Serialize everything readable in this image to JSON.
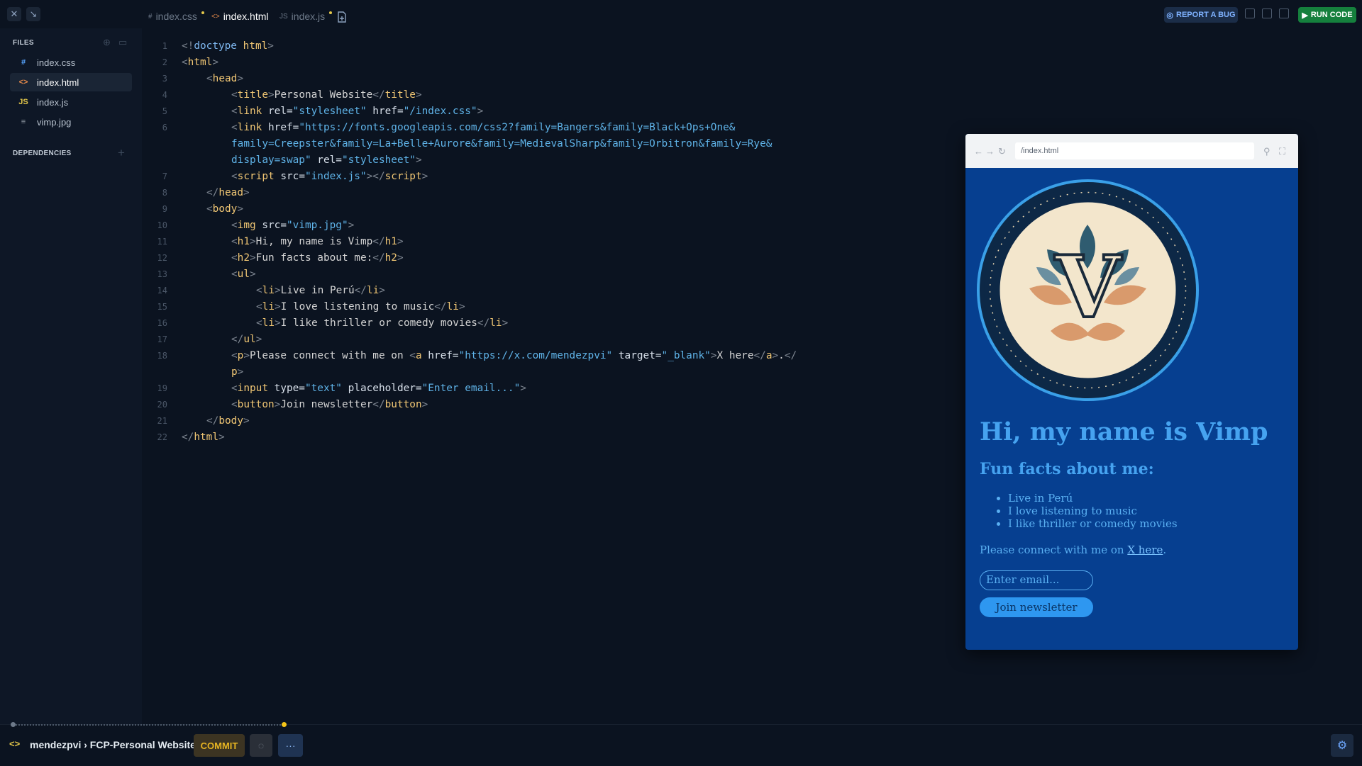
{
  "tabs": [
    {
      "icon": "#",
      "label": "index.css",
      "modified": true
    },
    {
      "icon": "<>",
      "label": "index.html",
      "modified": false,
      "active": true
    },
    {
      "icon": "JS",
      "label": "index.js",
      "modified": true
    }
  ],
  "toolbar": {
    "report_label": "REPORT A BUG",
    "run_label": "RUN CODE"
  },
  "sidebar": {
    "files_heading": "FILES",
    "dependencies_heading": "DEPENDENCIES",
    "files": [
      {
        "icon": "#",
        "name": "index.css",
        "icon_color": "#58a6ff"
      },
      {
        "icon": "<>",
        "name": "index.html",
        "icon_color": "#e2884a",
        "active": true
      },
      {
        "icon": "JS",
        "name": "index.js",
        "icon_color": "#e5c84a"
      },
      {
        "icon": "≡",
        "name": "vimp.jpg",
        "icon_color": "#8b949e"
      }
    ]
  },
  "editor": {
    "lines": [
      {
        "n": "1",
        "indent": 0,
        "tokens": [
          [
            "br",
            "<!"
          ],
          [
            "kw",
            "doctype "
          ],
          [
            "tag",
            "html"
          ],
          [
            "br",
            ">"
          ]
        ]
      },
      {
        "n": "2",
        "indent": 0,
        "tokens": [
          [
            "br",
            "<"
          ],
          [
            "tag",
            "html"
          ],
          [
            "br",
            ">"
          ]
        ]
      },
      {
        "n": "3",
        "indent": 1,
        "tokens": [
          [
            "br",
            "<"
          ],
          [
            "tag",
            "head"
          ],
          [
            "br",
            ">"
          ]
        ]
      },
      {
        "n": "4",
        "indent": 2,
        "tokens": [
          [
            "br",
            "<"
          ],
          [
            "tag",
            "title"
          ],
          [
            "br",
            ">"
          ],
          [
            "tx",
            "Personal Website"
          ],
          [
            "br",
            "</"
          ],
          [
            "tag",
            "title"
          ],
          [
            "br",
            ">"
          ]
        ]
      },
      {
        "n": "5",
        "indent": 2,
        "tokens": [
          [
            "br",
            "<"
          ],
          [
            "tag",
            "link "
          ],
          [
            "at",
            "rel="
          ],
          [
            "str",
            "\"stylesheet\""
          ],
          [
            "at",
            " href="
          ],
          [
            "str",
            "\"/index.css\""
          ],
          [
            "br",
            ">"
          ]
        ]
      },
      {
        "n": "6",
        "indent": 2,
        "tokens": [
          [
            "br",
            "<"
          ],
          [
            "tag",
            "link "
          ],
          [
            "at",
            "href="
          ],
          [
            "str",
            "\"https://fonts.googleapis.com/css2?family=Bangers&family=Black+Ops+One&"
          ]
        ]
      },
      {
        "n": "",
        "indent": 2,
        "tokens": [
          [
            "str",
            "family=Creepster&family=La+Belle+Aurore&family=MedievalSharp&family=Orbitron&family=Rye&"
          ]
        ]
      },
      {
        "n": "",
        "indent": 2,
        "tokens": [
          [
            "str",
            "display=swap\""
          ],
          [
            "at",
            " rel="
          ],
          [
            "str",
            "\"stylesheet\""
          ],
          [
            "br",
            ">"
          ]
        ]
      },
      {
        "n": "7",
        "indent": 2,
        "tokens": [
          [
            "br",
            "<"
          ],
          [
            "tag",
            "script "
          ],
          [
            "at",
            "src="
          ],
          [
            "str",
            "\"index.js\""
          ],
          [
            "br",
            "></"
          ],
          [
            "tag",
            "script"
          ],
          [
            "br",
            ">"
          ]
        ]
      },
      {
        "n": "8",
        "indent": 1,
        "tokens": [
          [
            "br",
            "</"
          ],
          [
            "tag",
            "head"
          ],
          [
            "br",
            ">"
          ]
        ]
      },
      {
        "n": "9",
        "indent": 1,
        "tokens": [
          [
            "br",
            "<"
          ],
          [
            "tag",
            "body"
          ],
          [
            "br",
            ">"
          ]
        ]
      },
      {
        "n": "10",
        "indent": 2,
        "tokens": [
          [
            "br",
            "<"
          ],
          [
            "tag",
            "img "
          ],
          [
            "at",
            "src="
          ],
          [
            "str",
            "\"vimp.jpg\""
          ],
          [
            "br",
            ">"
          ]
        ]
      },
      {
        "n": "11",
        "indent": 2,
        "tokens": [
          [
            "br",
            "<"
          ],
          [
            "tag",
            "h1"
          ],
          [
            "br",
            ">"
          ],
          [
            "tx",
            "Hi, my name is Vimp"
          ],
          [
            "br",
            "</"
          ],
          [
            "tag",
            "h1"
          ],
          [
            "br",
            ">"
          ]
        ]
      },
      {
        "n": "12",
        "indent": 2,
        "tokens": [
          [
            "br",
            "<"
          ],
          [
            "tag",
            "h2"
          ],
          [
            "br",
            ">"
          ],
          [
            "tx",
            "Fun facts about me:"
          ],
          [
            "br",
            "</"
          ],
          [
            "tag",
            "h2"
          ],
          [
            "br",
            ">"
          ]
        ]
      },
      {
        "n": "13",
        "indent": 2,
        "tokens": [
          [
            "br",
            "<"
          ],
          [
            "tag",
            "ul"
          ],
          [
            "br",
            ">"
          ]
        ]
      },
      {
        "n": "14",
        "indent": 3,
        "tokens": [
          [
            "br",
            "<"
          ],
          [
            "tag",
            "li"
          ],
          [
            "br",
            ">"
          ],
          [
            "tx",
            "Live in Perú"
          ],
          [
            "br",
            "</"
          ],
          [
            "tag",
            "li"
          ],
          [
            "br",
            ">"
          ]
        ]
      },
      {
        "n": "15",
        "indent": 3,
        "tokens": [
          [
            "br",
            "<"
          ],
          [
            "tag",
            "li"
          ],
          [
            "br",
            ">"
          ],
          [
            "tx",
            "I love listening to music"
          ],
          [
            "br",
            "</"
          ],
          [
            "tag",
            "li"
          ],
          [
            "br",
            ">"
          ]
        ]
      },
      {
        "n": "16",
        "indent": 3,
        "tokens": [
          [
            "br",
            "<"
          ],
          [
            "tag",
            "li"
          ],
          [
            "br",
            ">"
          ],
          [
            "tx",
            "I like thriller or comedy movies"
          ],
          [
            "br",
            "</"
          ],
          [
            "tag",
            "li"
          ],
          [
            "br",
            ">"
          ]
        ]
      },
      {
        "n": "17",
        "indent": 2,
        "tokens": [
          [
            "br",
            "</"
          ],
          [
            "tag",
            "ul"
          ],
          [
            "br",
            ">"
          ]
        ]
      },
      {
        "n": "18",
        "indent": 2,
        "tokens": [
          [
            "br",
            "<"
          ],
          [
            "tag",
            "p"
          ],
          [
            "br",
            ">"
          ],
          [
            "tx",
            "Please connect with me on "
          ],
          [
            "br",
            "<"
          ],
          [
            "tag",
            "a "
          ],
          [
            "at",
            "href="
          ],
          [
            "str",
            "\"https://x.com/mendezpvi\""
          ],
          [
            "at",
            " target="
          ],
          [
            "str",
            "\"_blank\""
          ],
          [
            "br",
            ">"
          ],
          [
            "tx",
            "X here"
          ],
          [
            "br",
            "</"
          ],
          [
            "tag",
            "a"
          ],
          [
            "br",
            ">"
          ],
          [
            "tx",
            "."
          ],
          [
            "br",
            "</"
          ]
        ]
      },
      {
        "n": "",
        "indent": 2,
        "tokens": [
          [
            "tag",
            "p"
          ],
          [
            "br",
            ">"
          ]
        ]
      },
      {
        "n": "19",
        "indent": 2,
        "tokens": [
          [
            "br",
            "<"
          ],
          [
            "tag",
            "input "
          ],
          [
            "at",
            "type="
          ],
          [
            "str",
            "\"text\""
          ],
          [
            "at",
            " placeholder="
          ],
          [
            "str",
            "\"Enter email...\""
          ],
          [
            "br",
            ">"
          ]
        ]
      },
      {
        "n": "20",
        "indent": 2,
        "tokens": [
          [
            "br",
            "<"
          ],
          [
            "tag",
            "button"
          ],
          [
            "br",
            ">"
          ],
          [
            "tx",
            "Join newsletter"
          ],
          [
            "br",
            "</"
          ],
          [
            "tag",
            "button"
          ],
          [
            "br",
            ">"
          ]
        ]
      },
      {
        "n": "21",
        "indent": 1,
        "tokens": [
          [
            "br",
            "</"
          ],
          [
            "tag",
            "body"
          ],
          [
            "br",
            ">"
          ]
        ]
      },
      {
        "n": "22",
        "indent": 0,
        "tokens": [
          [
            "br",
            "</"
          ],
          [
            "tag",
            "html"
          ],
          [
            "br",
            ">"
          ]
        ]
      }
    ]
  },
  "preview": {
    "url": "/index.html",
    "heading": "Hi, my name is Vimp",
    "subheading": "Fun facts about me:",
    "facts": [
      "Live in Perú",
      "I love listening to music",
      "I like thriller or comedy movies"
    ],
    "connect_text": "Please connect with me on ",
    "link_text": "X here",
    "connect_end": ".",
    "email_placeholder": "Enter email...",
    "button_label": "Join newsletter",
    "logo_letter": "V"
  },
  "footer": {
    "repo_label": "mendezpvi › FCP-Personal Website",
    "commit_label": "COMMIT",
    "more_label": "···"
  }
}
